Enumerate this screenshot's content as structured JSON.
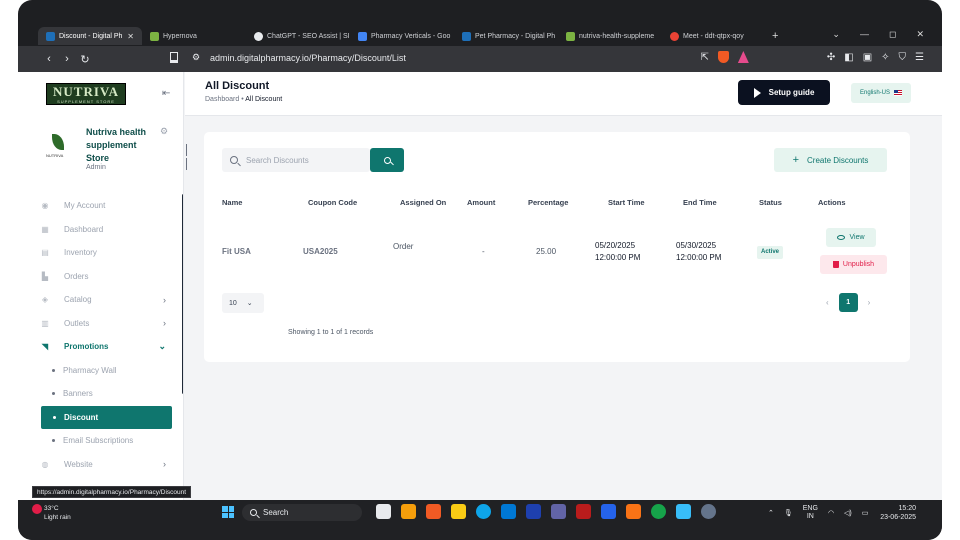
{
  "browser": {
    "tabs": [
      {
        "label": "Discount - Digital Ph",
        "active": true,
        "color": "#1e6fb8"
      },
      {
        "label": "Hypernova",
        "active": false,
        "color": "#7cb342"
      },
      {
        "label": "ChatGPT - SEO Assist | SI",
        "active": false,
        "color": "#e8eaed"
      },
      {
        "label": "Pharmacy Verticals - Goo",
        "active": false,
        "color": "#4285f4"
      },
      {
        "label": "Pet Pharmacy - Digital Ph",
        "active": false,
        "color": "#1e6fb8"
      },
      {
        "label": "nutriva-health-suppleme",
        "active": false,
        "color": "#7cb342"
      },
      {
        "label": "Meet - ddt-qtpx-qoy",
        "active": false,
        "color": "#ea4335"
      }
    ],
    "url": "admin.digitalpharmacy.io/Pharmacy/Discount/List",
    "status_url": "https://admin.digitalpharmacy.io/Pharmacy/Discount"
  },
  "sidebar": {
    "logo_text": "NUTRIVA",
    "logo_sub": "SUPPLEMENT STORE",
    "store_logo_text": "NUTRIVA",
    "store_name": "Nutriva health supplement Store",
    "store_role": "Admin",
    "items": [
      {
        "label": "My Account",
        "icon": "user-icon",
        "glyph": "◉",
        "chevron": ""
      },
      {
        "label": "Dashboard",
        "icon": "dashboard-icon",
        "glyph": "▦",
        "chevron": ""
      },
      {
        "label": "Inventory",
        "icon": "inventory-icon",
        "glyph": "▤",
        "chevron": ""
      },
      {
        "label": "Orders",
        "icon": "orders-icon",
        "glyph": "▙",
        "chevron": ""
      },
      {
        "label": "Catalog",
        "icon": "catalog-icon",
        "glyph": "◈",
        "chevron": "›"
      },
      {
        "label": "Outlets",
        "icon": "outlets-icon",
        "glyph": "▥",
        "chevron": "›"
      },
      {
        "label": "Promotions",
        "icon": "promotions-icon",
        "glyph": "◥",
        "chevron": "⌄"
      }
    ],
    "subitems": [
      {
        "label": "Pharmacy Wall"
      },
      {
        "label": "Banners"
      },
      {
        "label": "Discount"
      },
      {
        "label": "Email Subscriptions"
      }
    ],
    "after_items": [
      {
        "label": "Website",
        "icon": "website-icon",
        "glyph": "◍",
        "chevron": "›"
      }
    ]
  },
  "header": {
    "title": "All Discount",
    "breadcrumb_root": "Dashboard",
    "breadcrumb_sep": "•",
    "breadcrumb_current": "All Discount",
    "setup_label": "Setup guide",
    "lang_label": "English-US"
  },
  "discounts": {
    "search_placeholder": "Search Discounts",
    "create_label": "Create Discounts",
    "columns": [
      "Name",
      "Coupon Code",
      "Assigned On",
      "Amount",
      "Percentage",
      "Start Time",
      "End Time",
      "Status",
      "Actions"
    ],
    "rows": [
      {
        "name": "Fit USA",
        "coupon_code": "USA2025",
        "assigned_on": "Order",
        "amount": "-",
        "percentage": "25.00",
        "start_date": "05/20/2025",
        "start_time": "12:00:00 PM",
        "end_date": "05/30/2025",
        "end_time": "12:00:00 PM",
        "status": "Active",
        "view_label": "View",
        "unpublish_label": "Unpublish"
      }
    ],
    "page_size": "10",
    "records_text": "Showing 1 to 1 of 1 records",
    "current_page": "1",
    "prev_label": "‹",
    "next_label": "›"
  },
  "taskbar": {
    "temperature": "33°C",
    "weather": "Light rain",
    "search_label": "Search",
    "lang_line1": "ENG",
    "lang_line2": "IN",
    "time": "15:20",
    "date": "23-06-2025"
  },
  "colors": {
    "primary": "#0f766e",
    "danger": "#e11d48",
    "dark_button": "#0b1120"
  }
}
